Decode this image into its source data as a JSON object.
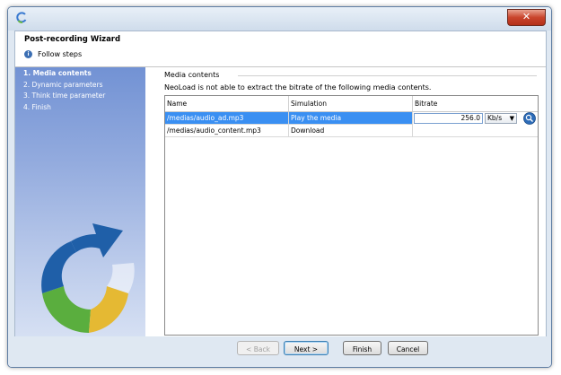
{
  "header": {
    "title": "Post-recording Wizard",
    "follow_steps": "Follow steps"
  },
  "sidebar": {
    "steps": [
      {
        "label": "1. Media contents",
        "active": true
      },
      {
        "label": "2. Dynamic parameters",
        "active": false
      },
      {
        "label": "3. Think time parameter",
        "active": false
      },
      {
        "label": "4. Finish",
        "active": false
      }
    ]
  },
  "main": {
    "section_title": "Media contents",
    "description": "NeoLoad is not able to extract the bitrate of the following media contents.",
    "columns": [
      "Name",
      "Simulation",
      "Bitrate"
    ],
    "rows": [
      {
        "name": "/medias/audio_ad.mp3",
        "simulation": "Play the media",
        "bitrate": "256.0",
        "unit": "Kb/s",
        "selected": true
      },
      {
        "name": "/medias/audio_content.mp3",
        "simulation": "Download",
        "bitrate": "",
        "unit": "",
        "selected": false
      }
    ]
  },
  "footer": {
    "back": "< Back",
    "next": "Next >",
    "finish": "Finish",
    "cancel": "Cancel"
  },
  "icons": {
    "app": "neoload-logo-icon",
    "info": "info-icon",
    "close": "close-icon",
    "search": "search-icon",
    "dropdown": "chevron-down-icon"
  },
  "colors": {
    "selection": "#3a8ff2",
    "sidebar_top": "#7292d4",
    "accent": "#3c6fb3"
  }
}
